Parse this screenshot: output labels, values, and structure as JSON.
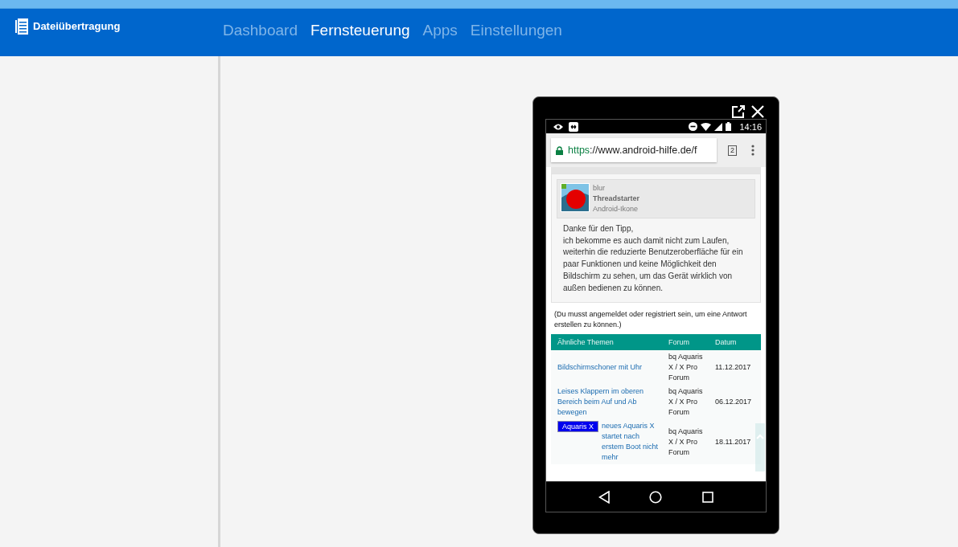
{
  "app": {
    "title": "Dateiübertragung"
  },
  "nav_tabs": [
    {
      "label": "Dashboard",
      "selected": false
    },
    {
      "label": "Fernsteuerung",
      "selected": true
    },
    {
      "label": "Apps",
      "selected": false
    },
    {
      "label": "Einstellungen",
      "selected": false
    }
  ],
  "phone": {
    "status_bar": {
      "time": "14:16"
    },
    "browser": {
      "url_scheme": "https",
      "url_rest": "://www.android-hilfe.de/f",
      "tab_count": "2"
    },
    "post": {
      "author": "blur",
      "role": "Threadstarter",
      "rank": "Android-Ikone",
      "body": "Danke für den Tipp,\nich bekomme es auch damit nicht zum Laufen, weiterhin die reduzierte Benutzeroberfläche für ein paar Funktionen und keine Möglichkeit den Bildschirm zu sehen, um das Gerät wirklich von außen bedienen zu können."
    },
    "note": "(Du musst angemeldet oder registriert sein, um eine Antwort erstellen zu können.)",
    "table": {
      "columns": [
        "Ähnliche Themen",
        "Forum",
        "Datum"
      ],
      "rows": [
        {
          "title": "Bildschirmschoner mit Uhr",
          "forum": "bq Aquaris X / X Pro Forum",
          "date": "11.12.2017"
        },
        {
          "title": "Leises Klappern im oberen Bereich beim Auf und Ab bewegen",
          "forum": "bq Aquaris X / X Pro Forum",
          "date": "06.12.2017"
        },
        {
          "badge": "Aquaris X",
          "title": "neues Aquaris X startet nach erstem Boot nicht mehr",
          "forum": "bq Aquaris X / X Pro Forum",
          "date": "18.11.2017"
        }
      ]
    }
  }
}
